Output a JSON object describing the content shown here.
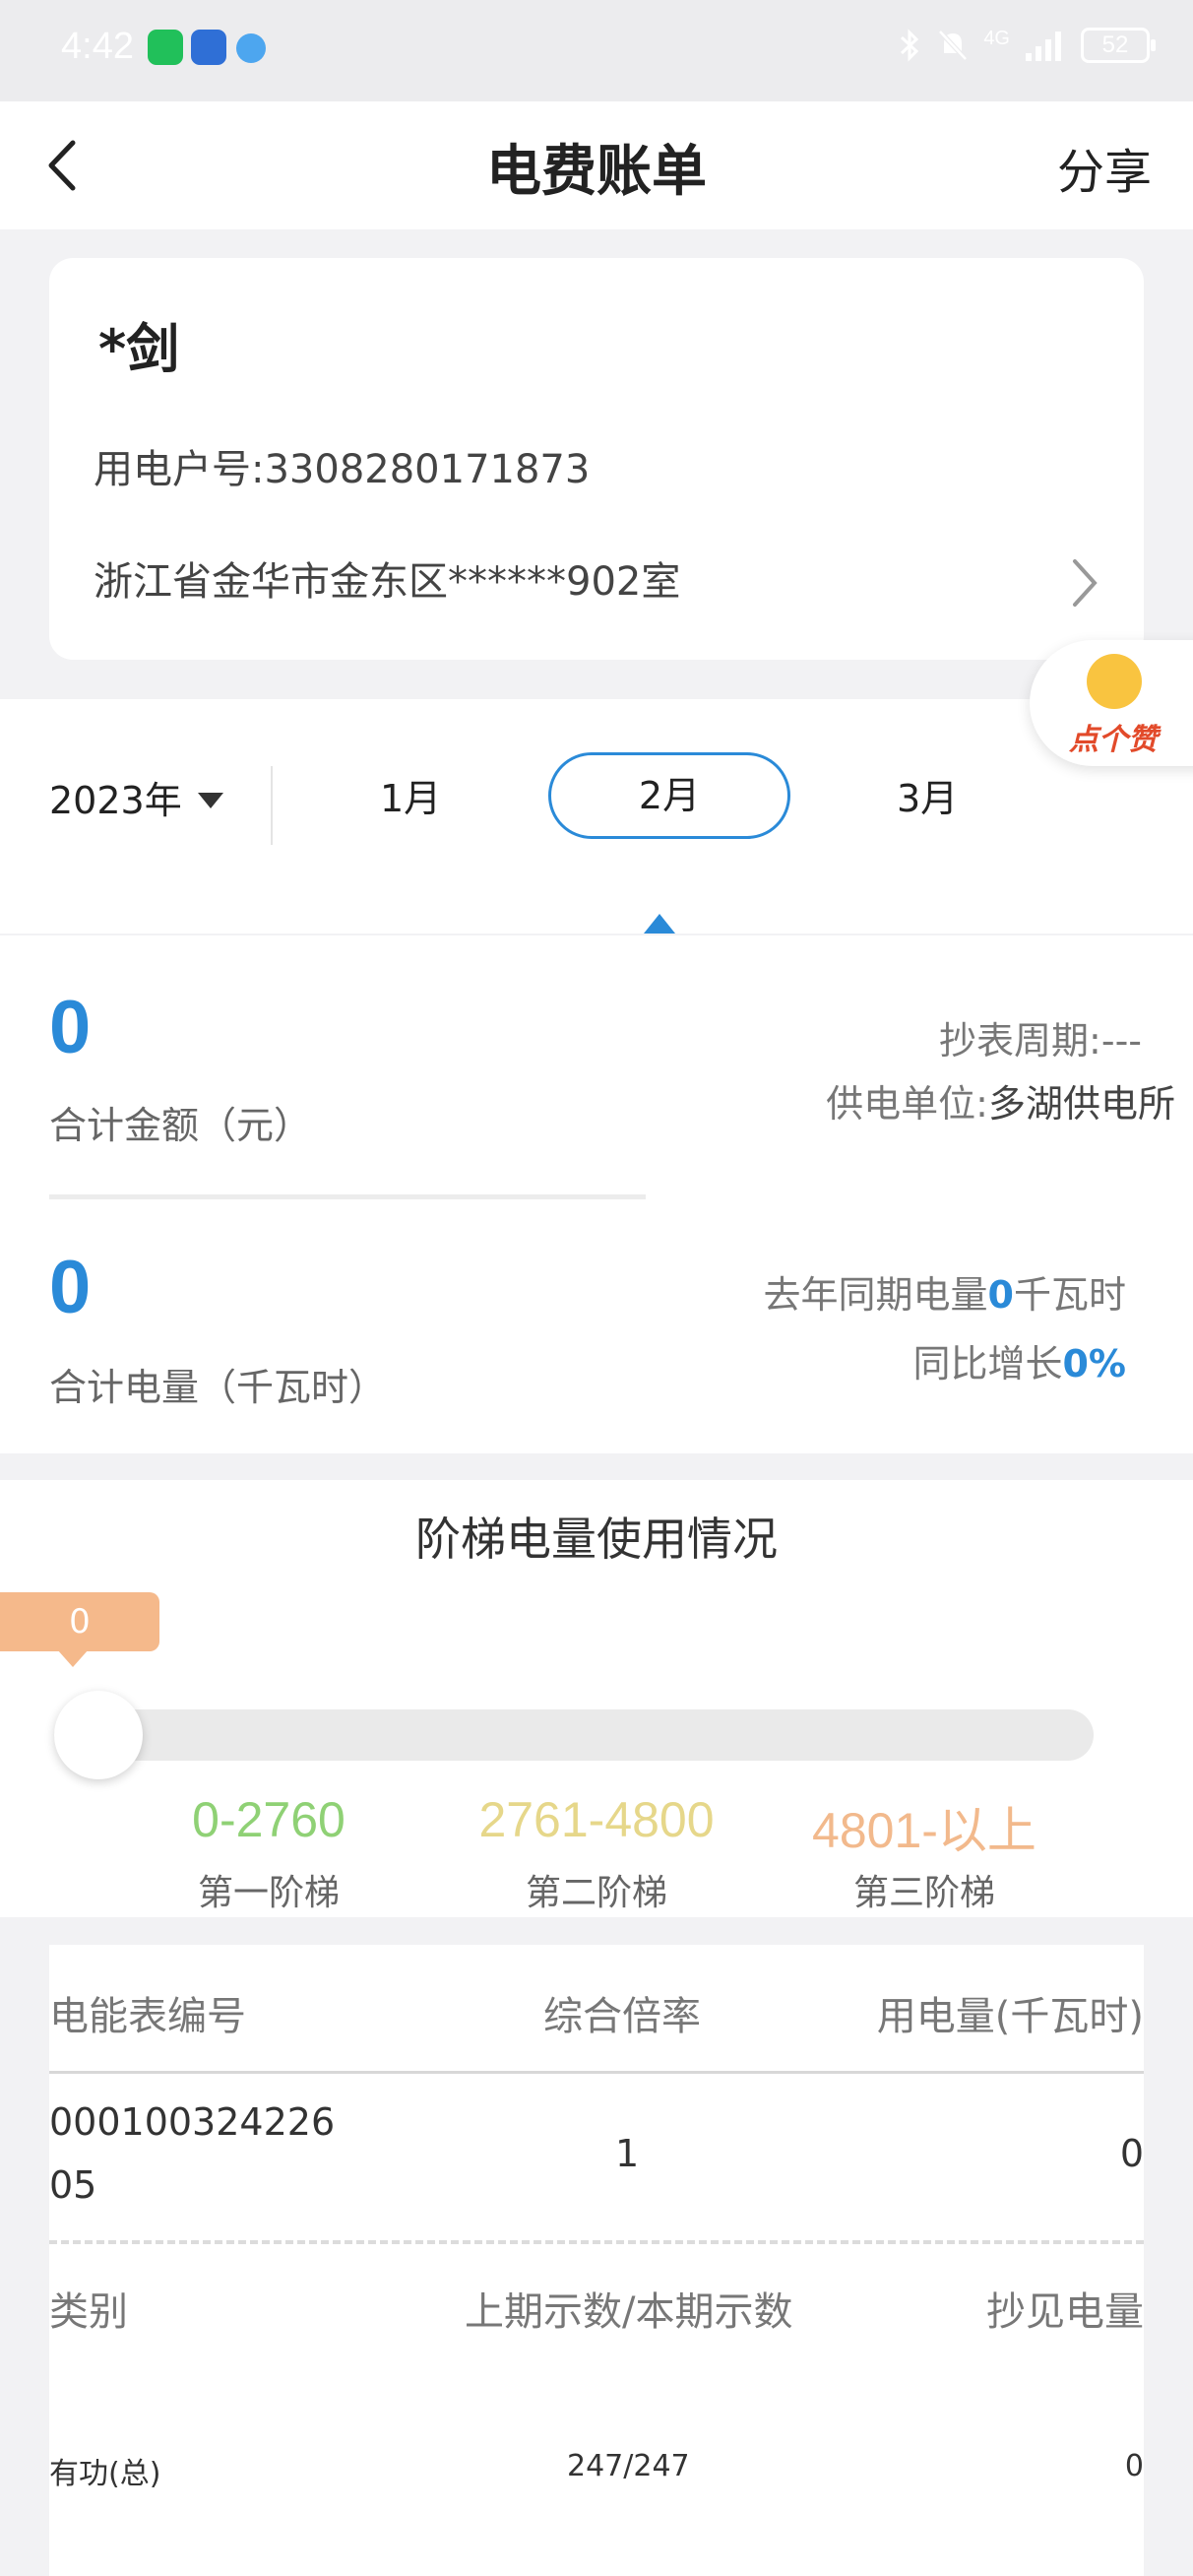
{
  "status_bar": {
    "time": "4:42",
    "signal": "4G",
    "battery": "52"
  },
  "nav": {
    "title": "电费账单",
    "share_label": "分享"
  },
  "account": {
    "name": "*剑",
    "account_no": "用电户号:3308280171873",
    "address": "浙江省金华市金东区******902室"
  },
  "period": {
    "year": "2023年",
    "months": [
      {
        "label": "1月",
        "selected": false
      },
      {
        "label": "2月",
        "selected": true
      },
      {
        "label": "3月",
        "selected": false
      }
    ]
  },
  "like_badge": "点个赞",
  "summary": {
    "total_amount": "0",
    "total_amount_label": "合计金额（元）",
    "reading_period_label": "抄表周期:",
    "reading_period_value": "---",
    "supply_unit_label": "供电单位:",
    "supply_unit_value": "多湖供电所",
    "total_energy": "0",
    "total_energy_label": "合计电量（千瓦时）",
    "last_year_prefix": "去年同期电量",
    "last_year_value": "0",
    "last_year_unit": "千瓦时",
    "yoy_label": "同比增长",
    "yoy_value": "0%"
  },
  "tier": {
    "title": "阶梯电量使用情况",
    "current_value": "0",
    "current_fraction": 0,
    "levels": [
      {
        "range": "0-2760",
        "name": "第一阶梯",
        "color": "#8fd175"
      },
      {
        "range": "2761-4800",
        "name": "第二阶梯",
        "color": "#e6d78a"
      },
      {
        "range": "4801-以上",
        "name": "第三阶梯",
        "color": "#f2b98c"
      }
    ]
  },
  "meter_table": {
    "headers": [
      "电能表编号",
      "综合倍率",
      "用电量(千瓦时)"
    ],
    "row": {
      "meter_no_line1": "000100324226",
      "meter_no_line2": "05",
      "multiplier": "1",
      "usage": "0"
    },
    "reading_headers": [
      "类别",
      "上期示数/本期示数",
      "抄见电量"
    ],
    "reading_row": {
      "category": "有功(总)",
      "readings": "247/247",
      "energy": "0"
    }
  },
  "colors": {
    "accent": "#2a8ad8",
    "tier_bubble": "#f5b98b"
  }
}
